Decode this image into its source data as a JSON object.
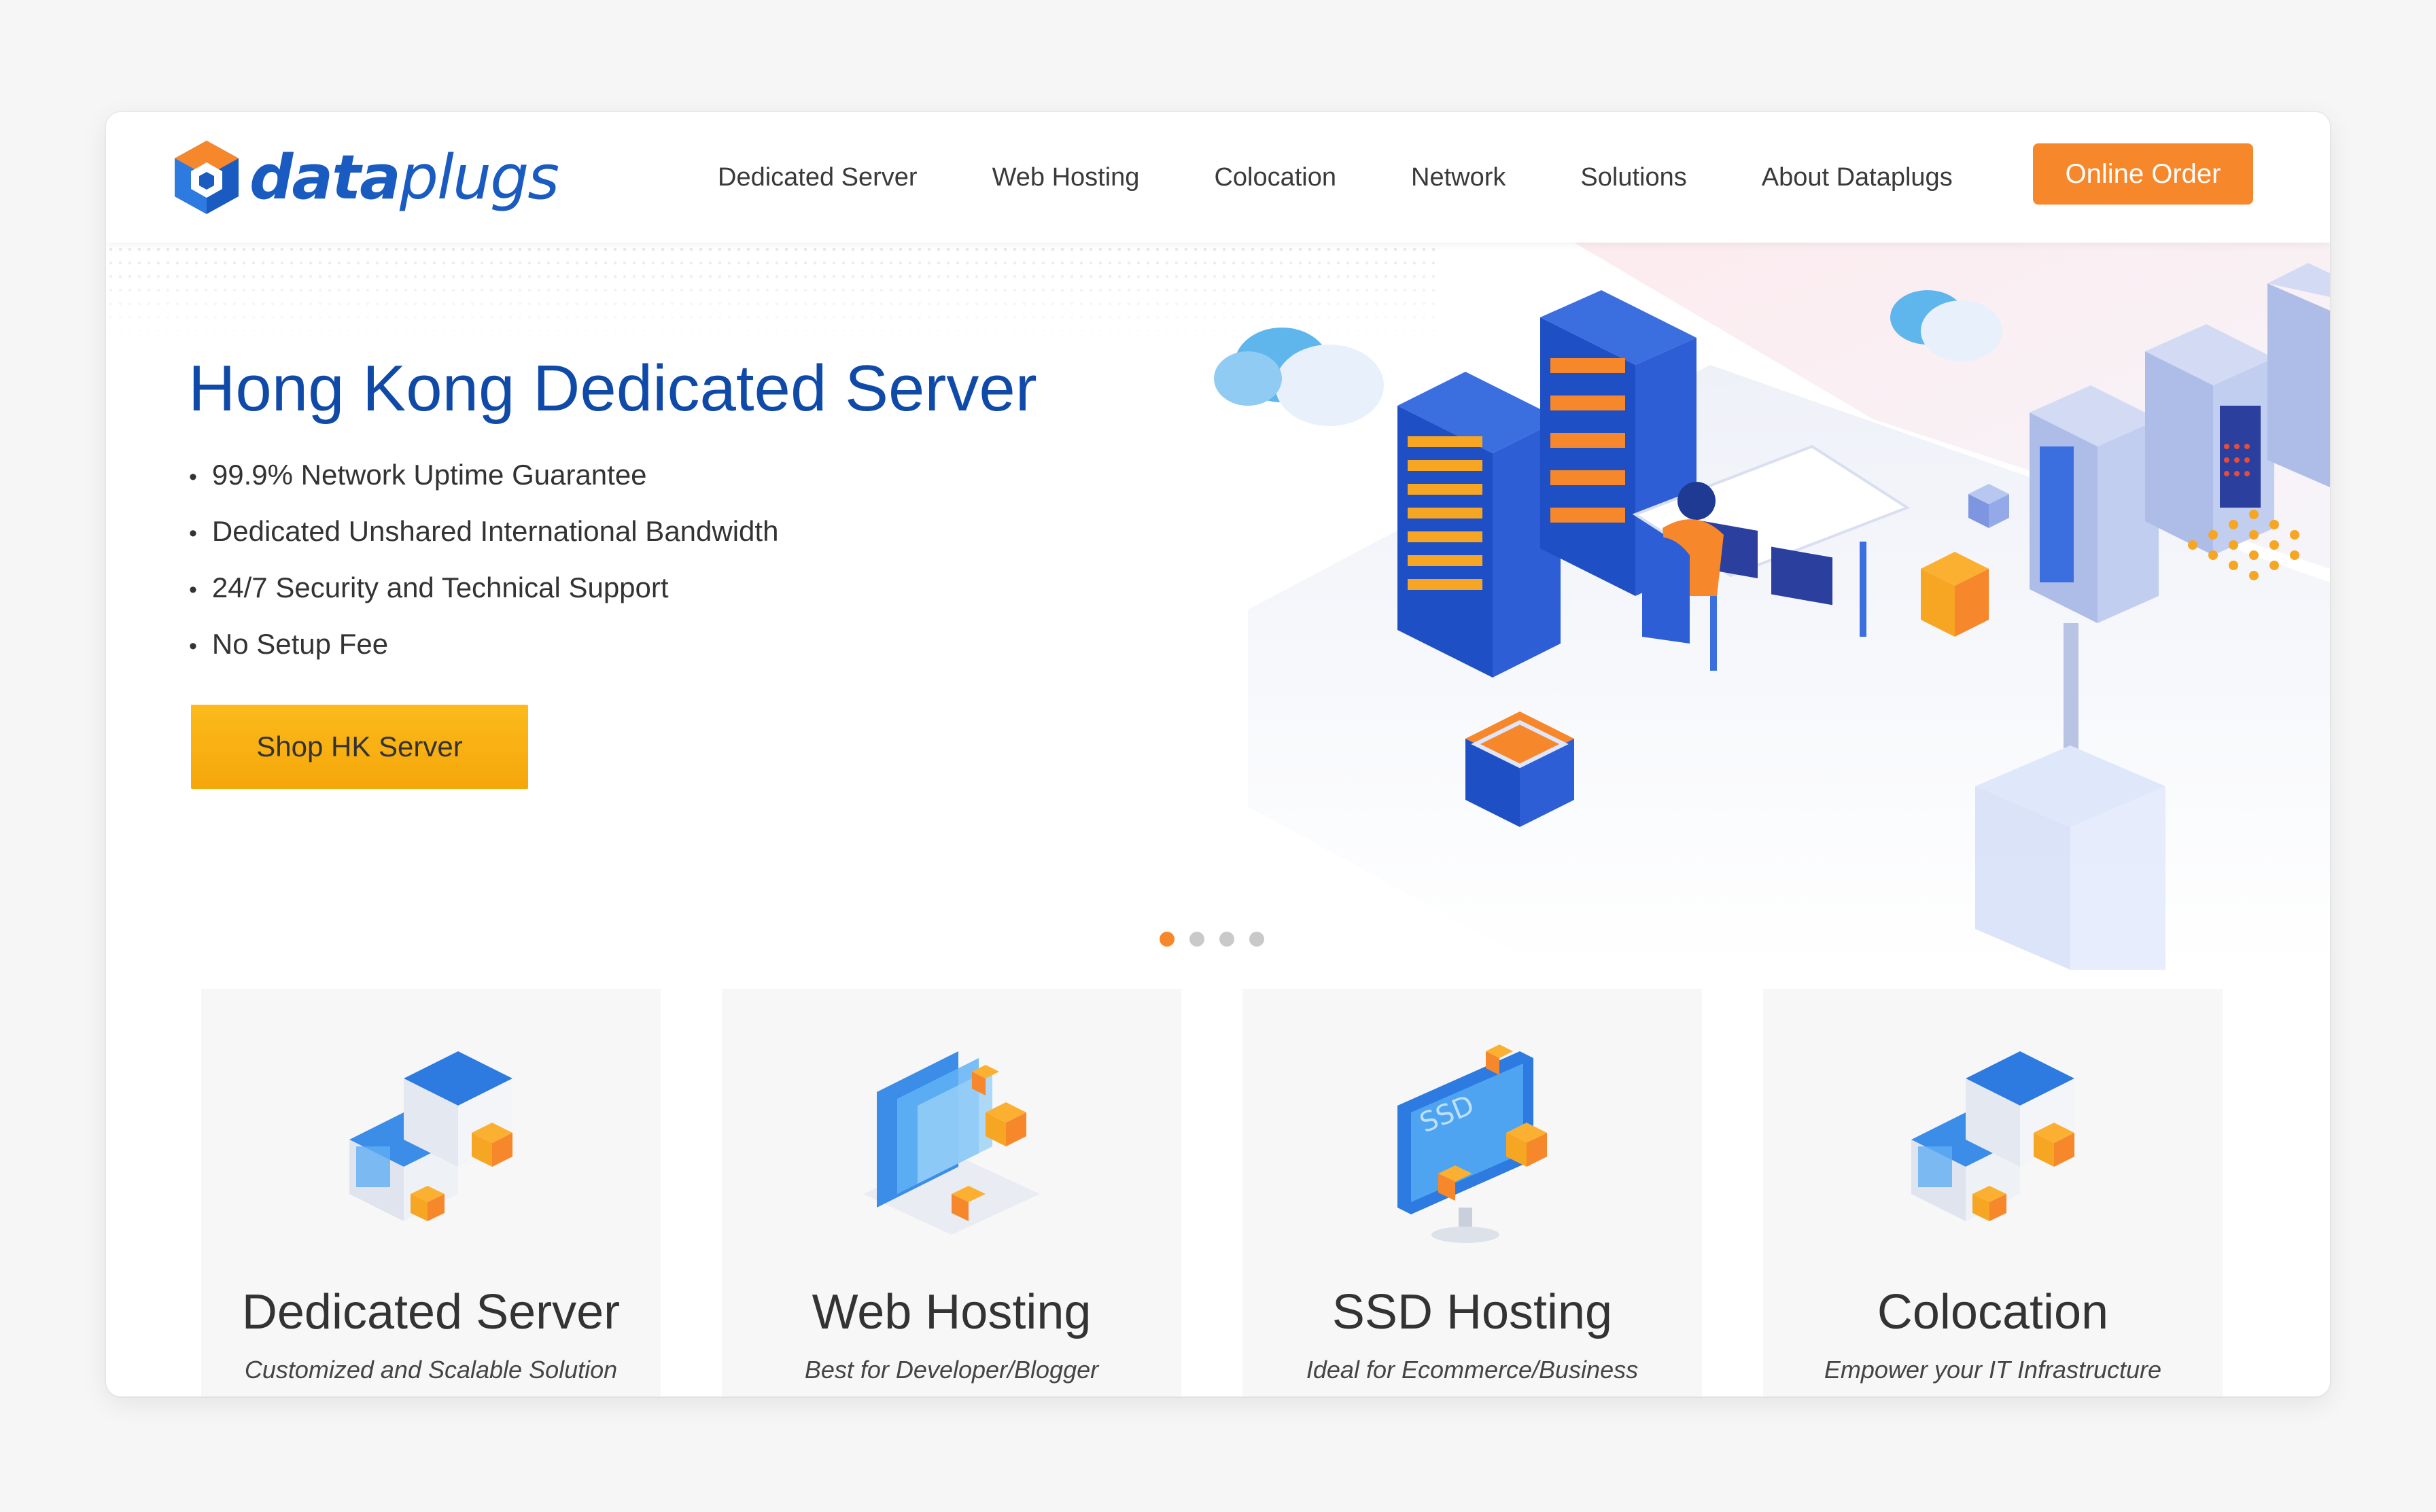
{
  "brand": {
    "logo_text_bold": "data",
    "logo_text_light": "plugs",
    "primary_color": "#1a5bc1",
    "accent_color": "#f6872b"
  },
  "nav": {
    "items": [
      {
        "label": "Dedicated Server"
      },
      {
        "label": "Web Hosting"
      },
      {
        "label": "Colocation"
      },
      {
        "label": "Network"
      },
      {
        "label": "Solutions"
      },
      {
        "label": "About Dataplugs"
      }
    ],
    "cta_label": "Online Order"
  },
  "hero": {
    "title": "Hong Kong Dedicated Server",
    "bullets": [
      "99.9% Network Uptime Guarantee",
      "Dedicated Unshared International Bandwidth",
      "24/7 Security and Technical Support",
      "No Setup Fee"
    ],
    "button_label": "Shop HK Server",
    "slider_count": 4,
    "slider_active_index": 0,
    "illustration_icon": "datacenter-illustration-icon"
  },
  "services": [
    {
      "title": "Dedicated Server",
      "subtitle": "Customized and Scalable Solution",
      "icon": "server-stack-icon"
    },
    {
      "title": "Web Hosting",
      "subtitle": "Best for Developer/Blogger",
      "icon": "laptop-hosting-icon"
    },
    {
      "title": "SSD Hosting",
      "subtitle": "Ideal for Ecommerce/Business",
      "icon": "ssd-monitor-icon"
    },
    {
      "title": "Colocation",
      "subtitle": "Empower your IT Infrastructure",
      "icon": "server-stack-icon"
    }
  ]
}
